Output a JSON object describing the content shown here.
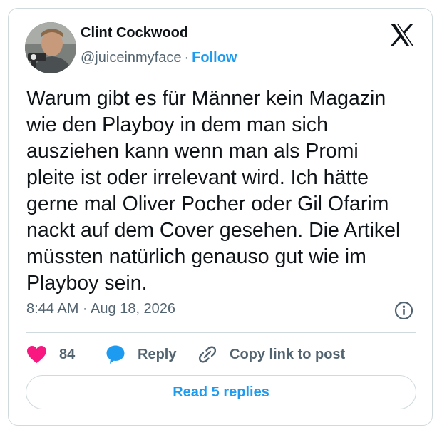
{
  "author": {
    "name": "Clint Cockwood",
    "handle": "@juiceinmyface",
    "separator": "·",
    "follow_label": "Follow"
  },
  "tweet": {
    "lines": [
      "Warum gibt es für Männer kein Magazin",
      "wie den Playboy in dem man sich",
      "ausziehen kann wenn man als Promi",
      "pleite ist oder irrelevant wird. Ich hätte",
      "gerne mal Oliver Pocher oder Gil Ofarim",
      "nackt auf dem Cover gesehen. Die Artikel",
      "müssten natürlich genauso gut wie im",
      "Playboy sein."
    ],
    "timestamp": "8:44 AM · Aug 18, 2026"
  },
  "actions": {
    "like_count": "84",
    "reply_label": "Reply",
    "copy_link_label": "Copy link to post"
  },
  "footer": {
    "read_replies_label": "Read 5 replies"
  },
  "icons": {
    "brand": "x-logo-icon",
    "info": "info-icon",
    "like": "heart-icon",
    "reply": "speech-bubble-icon",
    "copy": "link-icon"
  },
  "colors": {
    "accent": "#1d9bf0",
    "like": "#f91880",
    "text_primary": "#0f1419",
    "text_secondary": "#536471",
    "border": "#cfd9de"
  }
}
